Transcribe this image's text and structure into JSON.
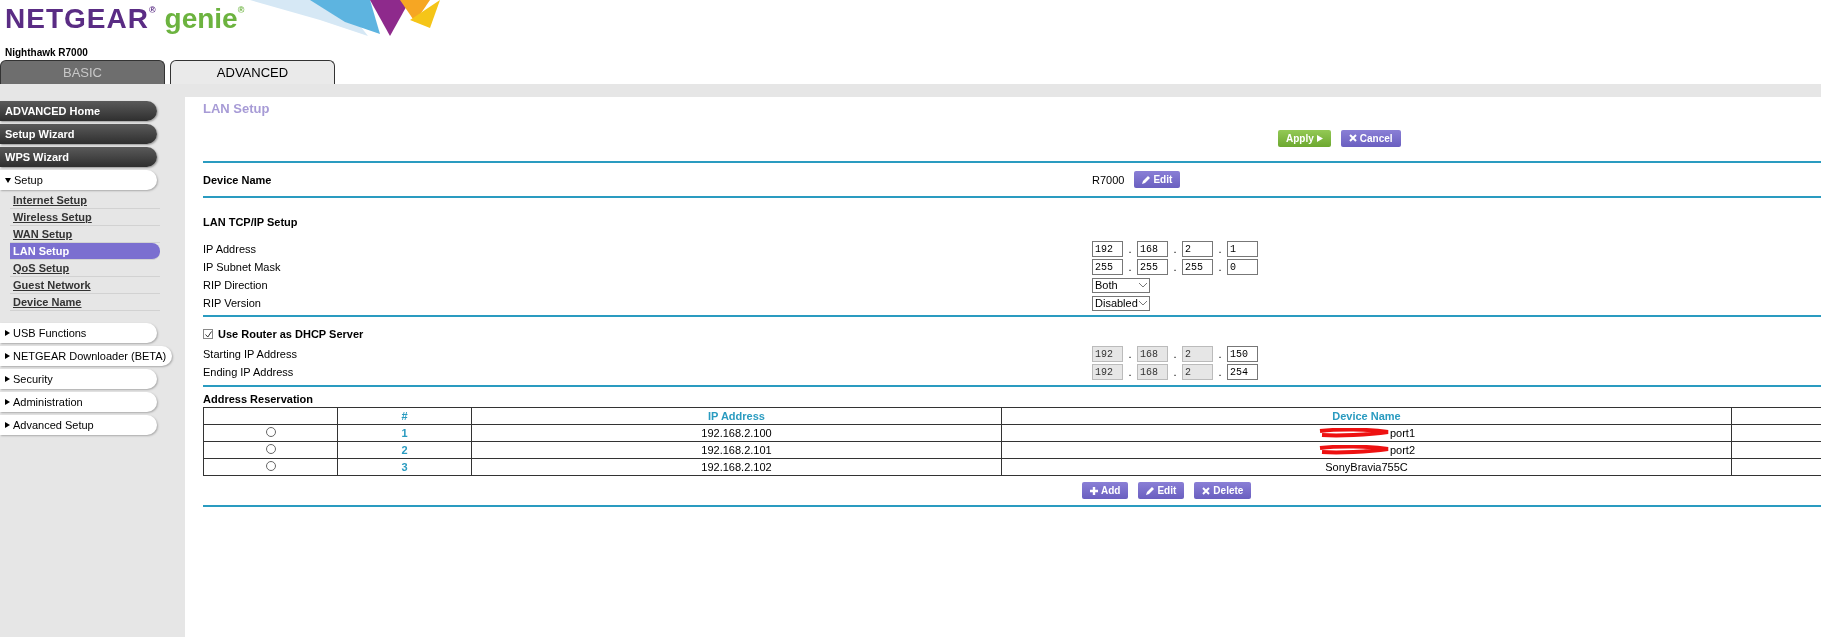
{
  "brand": {
    "name": "NETGEAR$^{®}$",
    "product": "genie$^{®}$"
  },
  "model": "Nighthawk R7000",
  "tabs": [
    {
      "label": "BASIC",
      "selected": false
    },
    {
      "label": "ADVANCED",
      "selected": true
    }
  ],
  "sidebar": {
    "items": [
      {
        "label": "ADVANCED Home",
        "kind": "link"
      },
      {
        "label": "Setup Wizard",
        "kind": "link"
      },
      {
        "label": "WPS Wizard",
        "kind": "link"
      },
      {
        "label": "Setup",
        "kind": "section",
        "expanded": true,
        "children": [
          {
            "label": "Internet Setup",
            "selected": false
          },
          {
            "label": "Wireless Setup",
            "selected": false
          },
          {
            "label": "WAN Setup",
            "selected": false
          },
          {
            "label": "LAN Setup",
            "selected": true
          },
          {
            "label": "QoS Setup",
            "selected": false
          },
          {
            "label": "Guest Network",
            "selected": false
          },
          {
            "label": "Device Name",
            "selected": false
          }
        ]
      },
      {
        "label": "USB Functions",
        "kind": "section",
        "expanded": false
      },
      {
        "label": "NETGEAR Downloader (BETA)",
        "kind": "section",
        "expanded": false
      },
      {
        "label": "Security",
        "kind": "section",
        "expanded": false
      },
      {
        "label": "Administration",
        "kind": "section",
        "expanded": false
      },
      {
        "label": "Advanced Setup",
        "kind": "section",
        "expanded": false
      }
    ]
  },
  "page": {
    "title": "LAN Setup",
    "buttons": [
      {
        "label": "Apply",
        "kind": "apply"
      },
      {
        "label": "Cancel",
        "kind": "cancel"
      }
    ],
    "device_name": {
      "label": "Device Name",
      "value": "R7000",
      "button": {
        "label": "Edit",
        "kind": "edit"
      }
    },
    "lan_tcpip": {
      "heading": "LAN TCP/IP Setup",
      "fields": [
        {
          "label": "IP Address",
          "kind": "ip",
          "separators": [
            ".",
            ".",
            "."
          ],
          "octets": [
            {
              "value": "192",
              "disabled": false
            },
            {
              "value": "168",
              "disabled": false
            },
            {
              "value": "2",
              "disabled": false
            },
            {
              "value": "1",
              "disabled": false
            }
          ]
        },
        {
          "label": "IP Subnet Mask",
          "kind": "ip",
          "separators": [
            ".",
            ".",
            "."
          ],
          "octets": [
            {
              "value": "255",
              "disabled": false
            },
            {
              "value": "255",
              "disabled": false
            },
            {
              "value": "255",
              "disabled": false
            },
            {
              "value": "0",
              "disabled": false
            }
          ]
        },
        {
          "label": "RIP Direction",
          "kind": "select",
          "value": "Both"
        },
        {
          "label": "RIP Version",
          "kind": "select",
          "value": "Disabled"
        }
      ]
    },
    "dhcp": {
      "label": "Use Router as DHCP Server",
      "checked": true,
      "fields": [
        {
          "label": "Starting IP Address",
          "kind": "ip",
          "separators": [
            ".",
            ".",
            "."
          ],
          "octets": [
            {
              "value": "192",
              "disabled": true
            },
            {
              "value": "168",
              "disabled": true
            },
            {
              "value": "2",
              "disabled": true
            },
            {
              "value": "150",
              "disabled": false
            }
          ]
        },
        {
          "label": "Ending IP Address",
          "kind": "ip",
          "separators": [
            ".",
            ".",
            "."
          ],
          "octets": [
            {
              "value": "192",
              "disabled": true
            },
            {
              "value": "168",
              "disabled": true
            },
            {
              "value": "2",
              "disabled": true
            },
            {
              "value": "254",
              "disabled": false
            }
          ]
        }
      ]
    },
    "reservation": {
      "heading": "Address Reservation",
      "columns": [
        "#",
        "IP Address",
        "Device Name"
      ],
      "rows": [
        {
          "selected": false,
          "number": "1",
          "ip": "192.168.2.100",
          "device": "port1",
          "redacted": true
        },
        {
          "selected": false,
          "number": "2",
          "ip": "192.168.2.101",
          "device": "port2",
          "redacted": true
        },
        {
          "selected": false,
          "number": "3",
          "ip": "192.168.2.102",
          "device": "SonyBravia755C",
          "redacted": false
        }
      ],
      "buttons": [
        {
          "label": "Add",
          "kind": "add"
        },
        {
          "label": "Edit",
          "kind": "edit"
        },
        {
          "label": "Delete",
          "kind": "delete"
        }
      ]
    }
  }
}
